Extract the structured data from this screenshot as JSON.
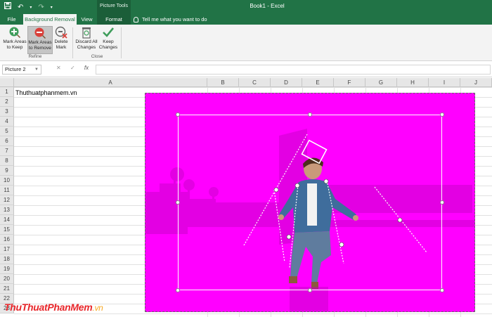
{
  "quick_access": {
    "save_icon": "save-icon",
    "undo_icon": "undo-icon",
    "redo_icon": "redo-icon",
    "customize_icon": "customize-qat-icon"
  },
  "contextual_header": "Picture Tools",
  "document_title": "Book1 - Excel",
  "tabs": [
    {
      "label": "File"
    },
    {
      "label": "Background Removal"
    },
    {
      "label": "View"
    },
    {
      "label": "Format"
    }
  ],
  "tell_me": "Tell me what you want to do",
  "ribbon": {
    "buttons": [
      {
        "label": "Mark Areas to Keep",
        "line1": "Mark Areas",
        "line2": "to Keep",
        "icon": "plus-pencil-icon"
      },
      {
        "label": "Mark Areas to Remove",
        "line1": "Mark Areas",
        "line2": "to Remove",
        "icon": "minus-pencil-icon"
      },
      {
        "label": "Delete Mark",
        "line1": "Delete",
        "line2": "Mark",
        "icon": "delete-mark-icon"
      },
      {
        "label": "Discard All Changes",
        "line1": "Discard All",
        "line2": "Changes",
        "icon": "trash-icon"
      },
      {
        "label": "Keep Changes",
        "line1": "Keep",
        "line2": "Changes",
        "icon": "checkmark-icon"
      }
    ],
    "groups": [
      {
        "label": "Refine"
      },
      {
        "label": "Close"
      }
    ]
  },
  "formula_bar": {
    "name_box": "Picture 2",
    "cancel": "✕",
    "enter": "✓",
    "fx": "fx",
    "value": ""
  },
  "columns": [
    "A",
    "B",
    "C",
    "D",
    "E",
    "F",
    "G",
    "H",
    "I",
    "J"
  ],
  "rows": [
    "1",
    "2",
    "3",
    "4",
    "5",
    "6",
    "7",
    "8",
    "9",
    "10",
    "11",
    "12",
    "13",
    "14",
    "15",
    "16",
    "17",
    "18",
    "19",
    "20",
    "21",
    "22",
    "23"
  ],
  "cells": {
    "A1": "Thuthuatphanmem.vn"
  },
  "watermark": {
    "part1": "Thu",
    "part2": "ThuatPhanMem",
    "part3": ".vn"
  },
  "colors": {
    "excel_green": "#217346",
    "removal_magenta": "#ff00ff",
    "active_tab_text": "#217346"
  }
}
